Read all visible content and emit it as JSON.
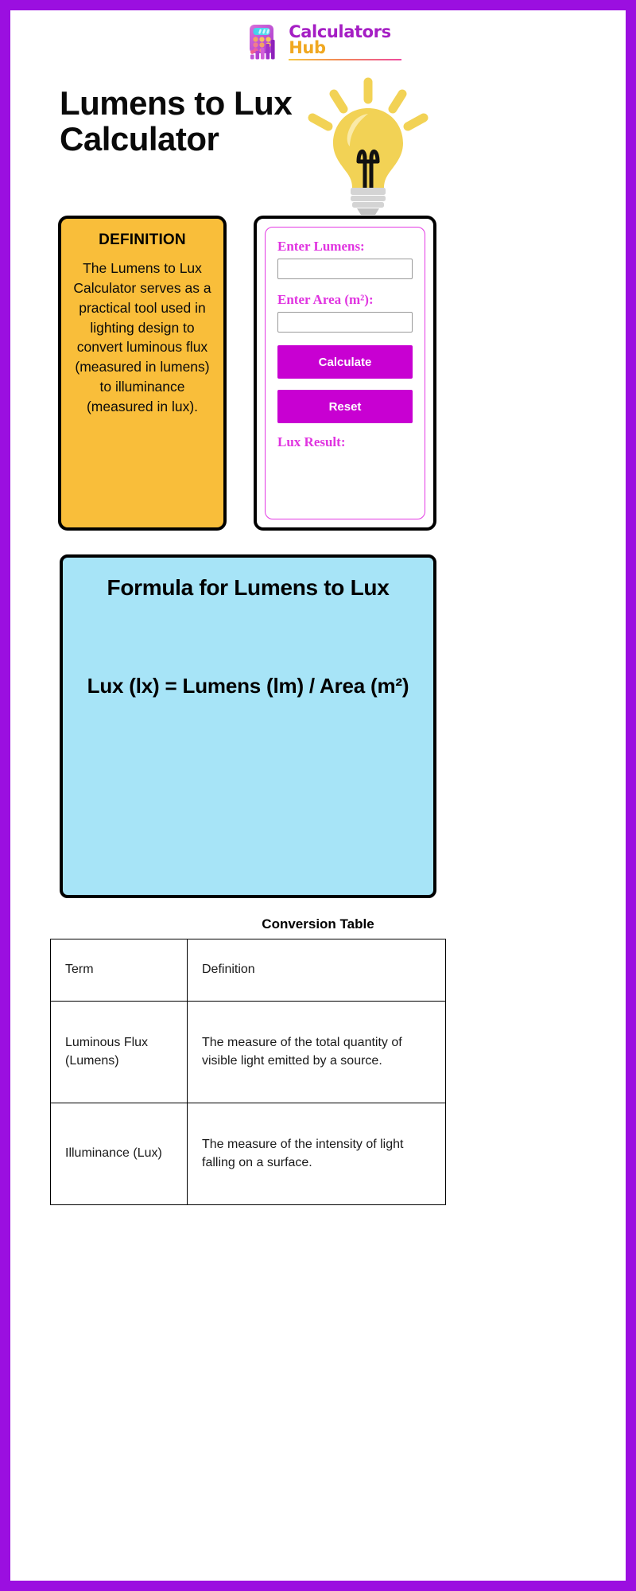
{
  "theme": {
    "frame_color": "#9b0fe0",
    "definition_bg": "#f9be3a",
    "formula_bg": "#a7e4f7",
    "accent_magenta": "#c800d2",
    "label_magenta": "#e033e0",
    "logo_purple": "#a51ec4",
    "logo_orange": "#f0a821",
    "bulb_yellow": "#f2d255"
  },
  "brand": {
    "name_primary": "Calculators",
    "name_secondary": "Hub",
    "logo_icon": "calculator-chart-icon"
  },
  "header": {
    "title": "Lumens to Lux Calculator",
    "illustration": "lightbulb-icon"
  },
  "definition": {
    "heading": "DEFINITION",
    "text": "The Lumens to Lux Calculator serves as a practical tool used in lighting design to convert luminous flux (measured in lumens) to illuminance (measured in lux)."
  },
  "calculator": {
    "lumens_label": "Enter Lumens:",
    "lumens_value": "",
    "lumens_placeholder": "",
    "area_label": "Enter Area (m²):",
    "area_value": "",
    "area_placeholder": "",
    "calculate_label": "Calculate",
    "reset_label": "Reset",
    "result_label": "Lux Result:",
    "result_value": ""
  },
  "formula": {
    "heading": "Formula for Lumens to Lux",
    "equation": "Lux (lx) = Lumens (lm) / Area (m²)"
  },
  "conversion_table": {
    "heading": "Conversion Table",
    "columns": [
      "Term",
      "Definition"
    ],
    "rows": [
      {
        "term": "Luminous Flux (Lumens)",
        "definition": "The measure of the total quantity of visible light emitted by a source."
      },
      {
        "term": "Illuminance (Lux)",
        "definition": "The measure of the intensity of light falling on a surface."
      }
    ]
  }
}
